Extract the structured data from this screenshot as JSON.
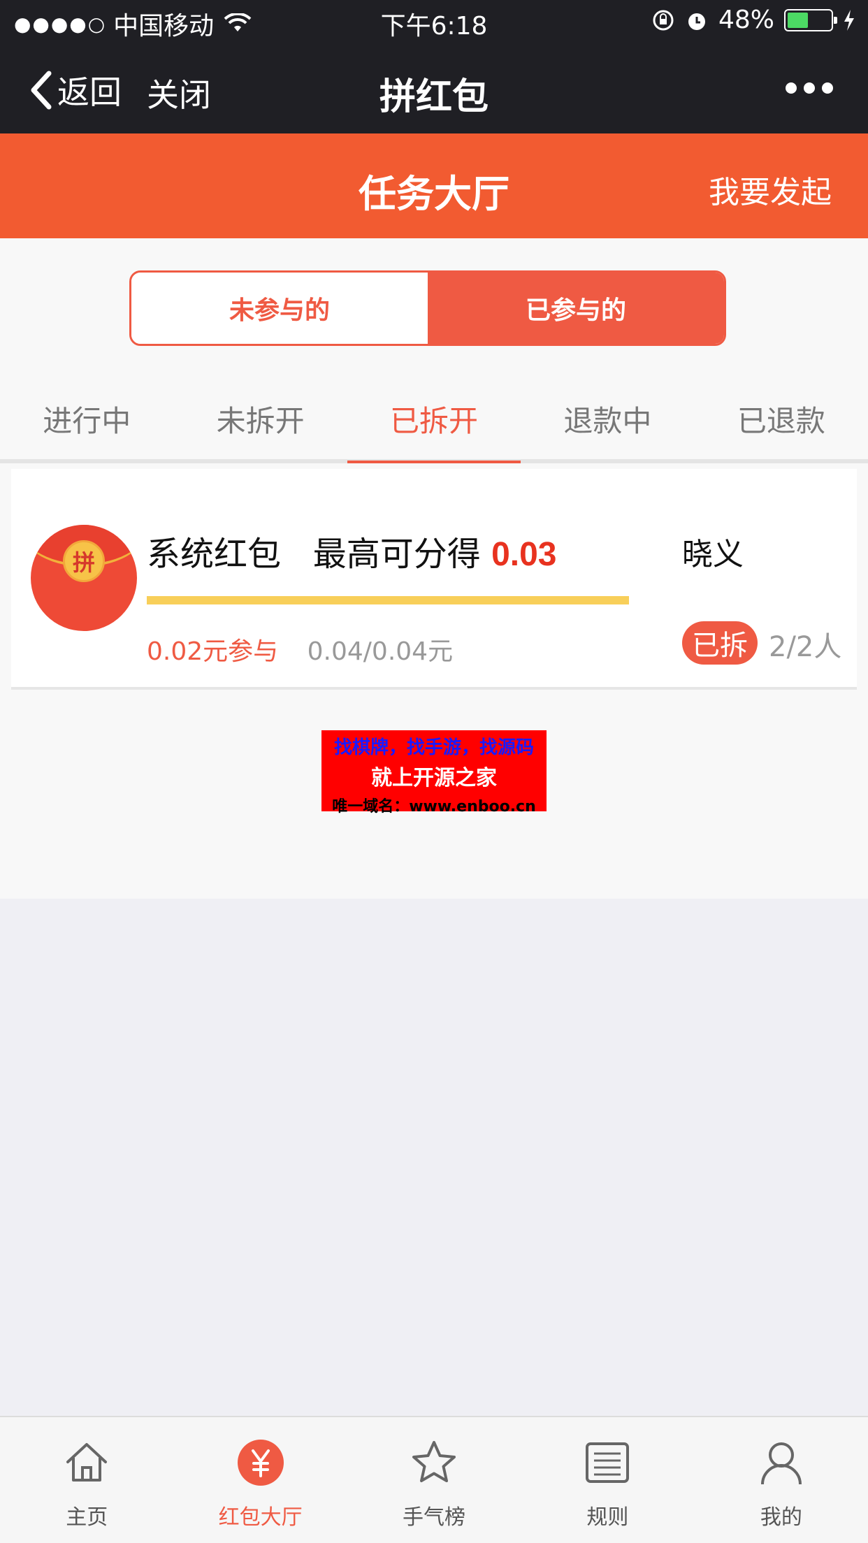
{
  "status_bar": {
    "signal": "●●●●○",
    "carrier": "中国移动",
    "time": "下午6:18",
    "battery_text": "48%",
    "battery_level": 0.48
  },
  "nav": {
    "back_label": "返回",
    "close_label": "关闭",
    "title": "拼红包"
  },
  "header": {
    "title": "任务大厅",
    "action_label": "我要发起",
    "accent": "#f25b31"
  },
  "segment": {
    "options": [
      "未参与的",
      "已参与的"
    ],
    "selected_index": 1
  },
  "tabs": {
    "items": [
      "进行中",
      "未拆开",
      "已拆开",
      "退款中",
      "已退款"
    ],
    "active_index": 2
  },
  "card": {
    "avatar_char": "拼",
    "title": "系统红包",
    "max_label": "最高可分得",
    "amount": "0.03",
    "progress": 1.0,
    "join_text": "0.02元参与",
    "pool_text": "0.04/0.04元",
    "user": "晓义",
    "status_badge": "已拆",
    "people": "2/2人"
  },
  "ad": {
    "line1": "找棋牌，找手游，找源码",
    "line2": "就上开源之家",
    "line3": "唯一域名：www.enboo.cn"
  },
  "tabbar": {
    "items": [
      {
        "label": "主页",
        "icon": "home-icon"
      },
      {
        "label": "红包大厅",
        "icon": "yuan-icon"
      },
      {
        "label": "手气榜",
        "icon": "star-icon"
      },
      {
        "label": "规则",
        "icon": "list-icon"
      },
      {
        "label": "我的",
        "icon": "user-icon"
      }
    ],
    "active_index": 1
  }
}
